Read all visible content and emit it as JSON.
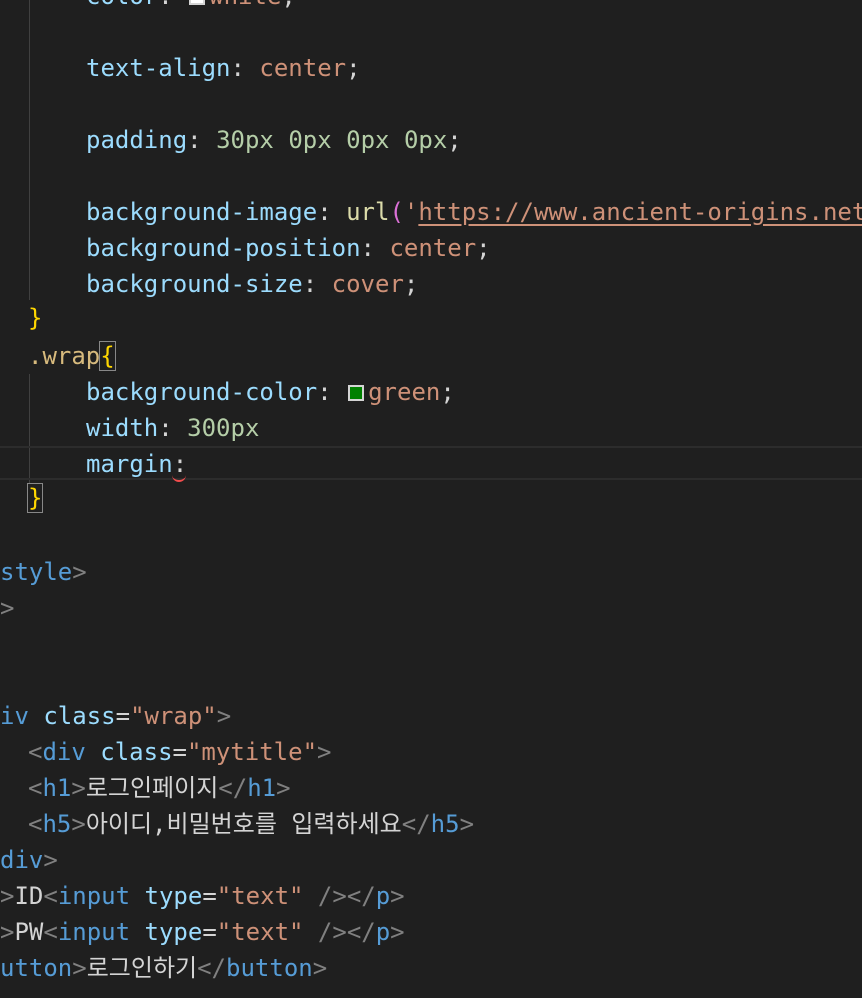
{
  "colors": {
    "background": "#1f1f1f",
    "property": "#9cdcfe",
    "string_value": "#ce9178",
    "number": "#b5cea8",
    "function": "#dcdcaa",
    "brace": "#ffd700",
    "selector": "#d7ba7d",
    "tag": "#569cd6",
    "swatch_white": "#ffffff",
    "swatch_green": "#008000",
    "error_squiggle": "#f14c4c"
  },
  "code": {
    "color_line": {
      "prop": "color",
      "colon": ":",
      "value": "white",
      "semi": ";"
    },
    "text_align": {
      "prop": "text-align",
      "colon": ": ",
      "value": "center",
      "semi": ";"
    },
    "padding": {
      "prop": "padding",
      "colon": ": ",
      "n1": "30px",
      "n2": "0px",
      "n3": "0px",
      "n4": "0px",
      "semi": ";"
    },
    "bg_image": {
      "prop": "background-image",
      "colon": ": ",
      "fn": "url",
      "open": "(",
      "quote": "'",
      "url": "https://www.ancient-origins.net"
    },
    "bg_position": {
      "prop": "background-position",
      "colon": ": ",
      "value": "center",
      "semi": ";"
    },
    "bg_size": {
      "prop": "background-size",
      "colon": ": ",
      "value": "cover",
      "semi": ";"
    },
    "close_brace_1": "}",
    "wrap_selector": ".wrap",
    "wrap_open": "{",
    "bg_color": {
      "prop": "background-color",
      "colon": ": ",
      "value": "green",
      "semi": ";"
    },
    "width": {
      "prop": "width",
      "colon": ": ",
      "value": "300px"
    },
    "margin": {
      "prop": "margin",
      "colon": ":"
    },
    "close_brace_2": "}",
    "style_close": {
      "tag": "style",
      "gt": ">"
    },
    "lone_gt": ">",
    "div_wrap": {
      "tag": "iv",
      "attr": "class",
      "eq": "=",
      "val": "\"wrap\"",
      "gt": ">"
    },
    "div_mytitle": {
      "lt": "<",
      "tag": "div",
      "attr": "class",
      "eq": "=",
      "val": "\"mytitle\"",
      "gt": ">"
    },
    "h1": {
      "lt": "<",
      "tag": "h1",
      "gt": ">",
      "text": "로그인페이지",
      "close_lt": "</",
      "close_tag": "h1",
      "close_gt": ">"
    },
    "h5": {
      "lt": "<",
      "tag": "h5",
      "gt": ">",
      "text": "아이디,비밀번호를 입력하세요",
      "close_lt": "</",
      "close_tag": "h5",
      "close_gt": ">"
    },
    "div_close": {
      "tag": "div",
      "gt": ">"
    },
    "p_id": {
      "gt": ">",
      "label": "ID",
      "lt": "<",
      "tag": "input",
      "attr": "type",
      "eq": "=",
      "val": "\"text\"",
      "selfclose": " /></",
      "ptag": "p",
      "end": ">"
    },
    "p_pw": {
      "gt": ">",
      "label": "PW",
      "lt": "<",
      "tag": "input",
      "attr": "type",
      "eq": "=",
      "val": "\"text\"",
      "selfclose": " /></",
      "ptag": "p",
      "end": ">"
    },
    "button": {
      "tag": "utton",
      "gt": ">",
      "text": "로그인하기",
      "close_lt": "</",
      "close_tag": "button",
      "close_gt": ">"
    }
  }
}
